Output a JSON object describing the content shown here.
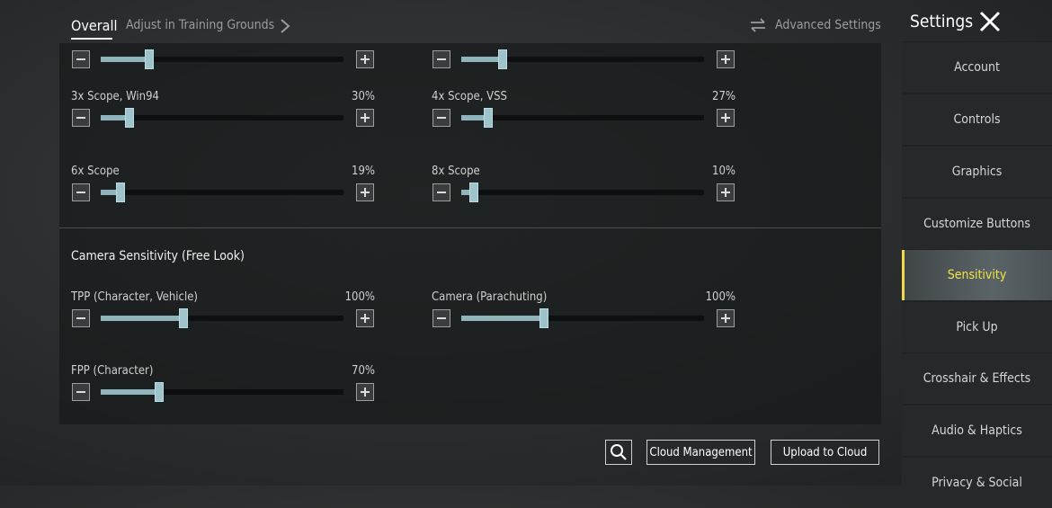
{
  "header": {
    "tab_overall": "Overall",
    "tab_adjust": "Adjust in Training Grounds",
    "advanced_settings": "Advanced Settings",
    "settings_title": "Settings"
  },
  "scope_sliders": [
    {
      "label": "",
      "value": "",
      "level": 0.2
    },
    {
      "label": "",
      "value": "",
      "level": 0.17
    },
    {
      "label": "3x Scope, Win94",
      "value": "30%",
      "level": 0.12
    },
    {
      "label": "4x Scope, VSS",
      "value": "27%",
      "level": 0.11
    },
    {
      "label": "6x Scope",
      "value": "19%",
      "level": 0.08
    },
    {
      "label": "8x Scope",
      "value": "10%",
      "level": 0.05
    }
  ],
  "camera_section": {
    "title": "Camera Sensitivity (Free Look)",
    "sliders": [
      {
        "label": "TPP (Character, Vehicle)",
        "value": "100%",
        "level": 0.34
      },
      {
        "label": "Camera (Parachuting)",
        "value": "100%",
        "level": 0.34
      },
      {
        "label": "FPP (Character)",
        "value": "70%",
        "level": 0.24
      }
    ]
  },
  "bottom": {
    "cloud_management": "Cloud Management",
    "upload_to_cloud": "Upload to Cloud"
  },
  "sidebar": {
    "items": [
      {
        "label": "Account",
        "active": false
      },
      {
        "label": "Controls",
        "active": false
      },
      {
        "label": "Graphics",
        "active": false
      },
      {
        "label": "Customize Buttons",
        "active": false
      },
      {
        "label": "Sensitivity",
        "active": true
      },
      {
        "label": "Pick Up",
        "active": false
      },
      {
        "label": "Crosshair & Effects",
        "active": false
      },
      {
        "label": "Audio & Haptics",
        "active": false
      },
      {
        "label": "Privacy & Social",
        "active": false
      }
    ]
  },
  "colors": {
    "accent": "#f2d94a",
    "slider_fill": "#8fb4bc"
  }
}
